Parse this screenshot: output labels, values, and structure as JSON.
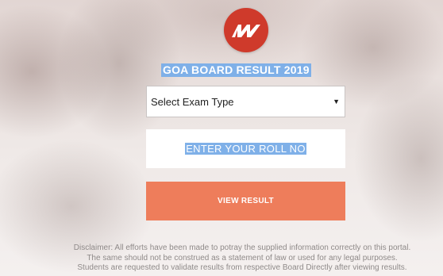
{
  "header": {
    "logo_icon": "mw-logo",
    "title": "GOA BOARD RESULT 2019"
  },
  "form": {
    "exam_type": {
      "selected": "Select Exam Type"
    },
    "roll_no": {
      "placeholder": "ENTER YOUR ROLL NO"
    },
    "submit_label": "VIEW RESULT"
  },
  "disclaimer": {
    "line1": "Disclaimer: All efforts have been made to potray the supplied information correctly on this portal.",
    "line2": "The same should not be construed as a statement of law or used for any legal purposes.",
    "line3": "Students are requested to validate results from respective Board Directly after viewing results."
  },
  "colors": {
    "logo_red": "#cf3a2b",
    "highlight_blue": "#7fb0e8",
    "button_orange": "#ee7d5b",
    "disclaimer_gray": "#8f8a89"
  }
}
